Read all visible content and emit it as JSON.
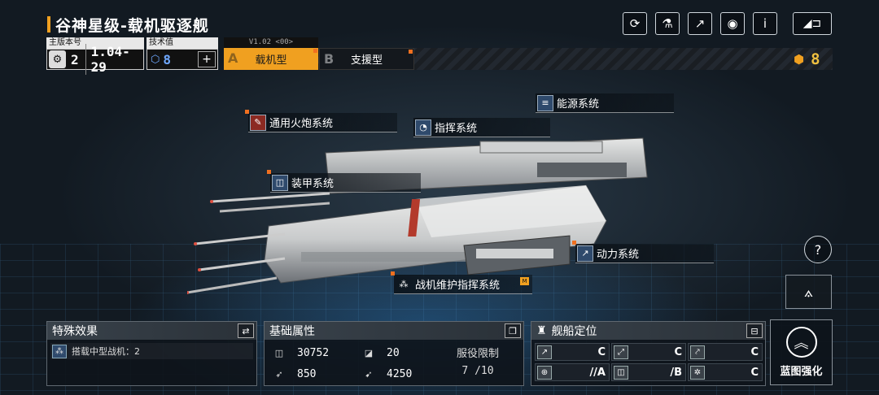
{
  "header": {
    "title": "谷神星级-载机驱逐舰",
    "icons": [
      "refresh-icon",
      "paint-icon",
      "share-icon",
      "view-icon",
      "info-icon"
    ],
    "icon_glyphs": [
      "⟳",
      "⚗",
      "↗",
      "◉",
      "i"
    ],
    "back_glyph": "◢⊐"
  },
  "version": {
    "label": "主版本号",
    "icon_glyph": "⚙",
    "major": "2",
    "value": "1.04-29"
  },
  "tech": {
    "label": "技术值",
    "value": "8",
    "add_glyph": "+"
  },
  "modes": {
    "version_tag": "V1.02 <00>",
    "tab_a_letter": "A",
    "tab_a_label": "载机型",
    "tab_b_letter": "B",
    "tab_b_label": "支援型"
  },
  "points": {
    "icon": "coin-icon",
    "value": "8"
  },
  "systems": {
    "energy": "能源系统",
    "cannon": "通用火炮系统",
    "command": "指挥系统",
    "armor": "装甲系统",
    "propulsion": "动力系统",
    "aircraft": "战机维护指挥系统",
    "aircraft_tag": "M"
  },
  "special": {
    "title": "特殊效果",
    "effect_text": "搭载中型战机：2"
  },
  "attributes": {
    "title": "基础属性",
    "hp": "30752",
    "armor": "20",
    "speed": "850",
    "warp": "4250",
    "service_label": "服役限制",
    "service_value": "7 /10"
  },
  "positioning": {
    "title": "舰船定位",
    "grades": [
      {
        "icon": "anti-ship-icon",
        "grade": "C"
      },
      {
        "icon": "anti-air-icon",
        "grade": "C"
      },
      {
        "icon": "siege-icon",
        "grade": "C"
      },
      {
        "icon": "target-icon",
        "grade": "//A"
      },
      {
        "icon": "shield-icon",
        "grade": "/B"
      },
      {
        "icon": "support-icon",
        "grade": "C"
      }
    ]
  },
  "blueprint": {
    "label": "蓝图强化"
  },
  "colors": {
    "accent": "#f0a020",
    "marker": "#f07020",
    "tech_blue": "#6fa8ff"
  }
}
